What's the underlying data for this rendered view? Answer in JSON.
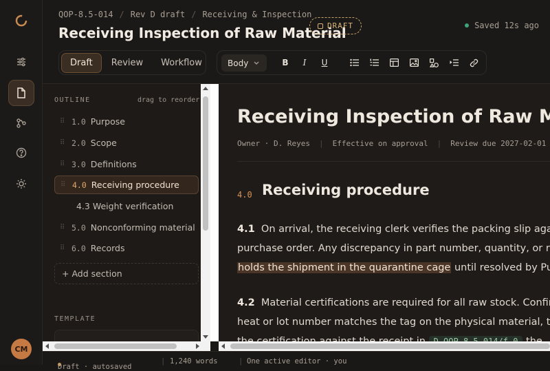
{
  "rail": {
    "items": [
      {
        "name": "settings-sliders-icon"
      },
      {
        "name": "document-icon",
        "active": true
      },
      {
        "name": "workflow-icon"
      },
      {
        "name": "help-icon"
      },
      {
        "name": "sun-icon"
      }
    ],
    "avatar_initials": "CM"
  },
  "header": {
    "breadcrumbs": [
      "QOP-8.5-014",
      "Rev D draft",
      "Receiving & Inspection"
    ],
    "title": "Receiving Inspection of Raw Material",
    "status_badge": "DRAFT",
    "saved_text": "Saved 12s ago"
  },
  "mode_tabs": [
    {
      "label": "Draft",
      "active": true
    },
    {
      "label": "Review",
      "active": false
    },
    {
      "label": "Workflow",
      "active": false
    }
  ],
  "toolbar": {
    "style_select": "Body",
    "buttons": [
      {
        "name": "bold-button",
        "glyph": "B"
      },
      {
        "name": "italic-button",
        "glyph": "I"
      },
      {
        "name": "underline-button",
        "glyph": "U"
      },
      {
        "name": "bullet-list-icon"
      },
      {
        "name": "numbered-list-icon"
      },
      {
        "name": "table-icon"
      },
      {
        "name": "image-icon"
      },
      {
        "name": "shapes-icon"
      },
      {
        "name": "indent-icon"
      },
      {
        "name": "link-icon"
      }
    ]
  },
  "sidebar": {
    "outline_label": "OUTLINE",
    "drag_hint": "drag to reorder",
    "items": [
      {
        "num": "1.0",
        "label": "Purpose"
      },
      {
        "num": "2.0",
        "label": "Scope"
      },
      {
        "num": "3.0",
        "label": "Definitions"
      },
      {
        "num": "4.0",
        "label": "Receiving procedure",
        "active": true
      },
      {
        "num": "",
        "label": "4.3 Weight verification",
        "sub": true
      },
      {
        "num": "5.0",
        "label": "Nonconforming material"
      },
      {
        "num": "6.0",
        "label": "Records"
      }
    ],
    "add_section": "+ Add section",
    "template_label": "TEMPLATE"
  },
  "editor": {
    "title": "Receiving Inspection of Raw Material",
    "meta": [
      "Owner · D. Reyes",
      "Effective on approval",
      "Review due 2027-02-01"
    ],
    "section_num": "4.0",
    "section_title": "Receiving procedure",
    "p1": {
      "num": "4.1",
      "line1": "On arrival, the receiving clerk verifies the packing slip against the",
      "line2": "purchase order. Any discrepancy in part number, quantity, or revision",
      "highlight": "holds the shipment in the quarantine cage",
      "line3_rest": " until resolved by Purchasing."
    },
    "p2": {
      "num": "4.2",
      "line1": "Material certifications are required for all raw stock. Confirm the",
      "line2": "heat or lot number matches the tag on the physical material, then file",
      "line3_pre": "the certification against the receipt in ",
      "code": "D-QOP-8.5-014/f.0",
      "line3_post": " the"
    }
  },
  "statusbar": {
    "state": "Draft · autosaved",
    "words": "1,240 words",
    "editors": "One active editor · you"
  }
}
